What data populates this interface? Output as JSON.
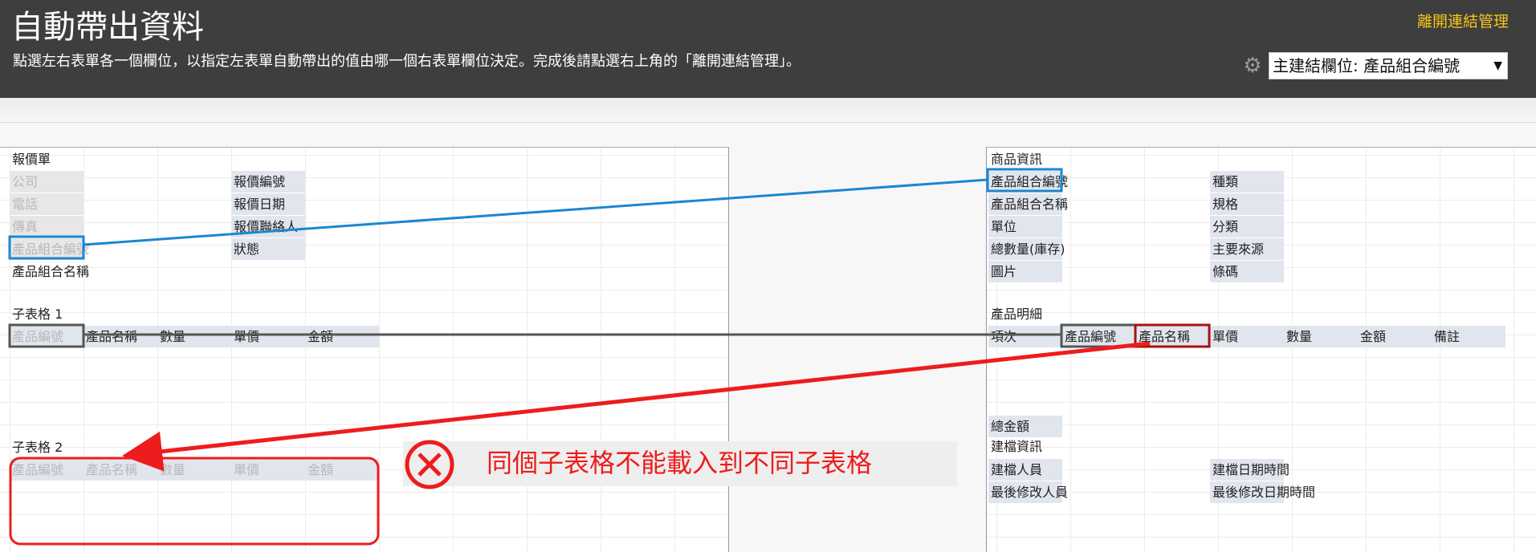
{
  "header": {
    "title": "自動帶出資料",
    "description": "點選左右表單各一個欄位，以指定左表單自動帶出的值由哪一個右表單欄位決定。完成後請點選右上角的「離開連結管理」。",
    "exit_link": "離開連結管理",
    "settings_icon": "gear-icon",
    "main_link_select": "主建結欄位: 產品組合編號"
  },
  "left_form": {
    "title": "報價單",
    "fields_col1": [
      "公司",
      "電話",
      "傳真",
      "產品組合編號",
      "產品組合名稱"
    ],
    "fields_col2": [
      "報價編號",
      "報價日期",
      "報價聯絡人",
      "狀態"
    ],
    "subtable1": {
      "title": "子表格 1",
      "columns": [
        "產品編號",
        "產品名稱",
        "數量",
        "單價",
        "金額"
      ]
    },
    "subtable2": {
      "title": "子表格 2",
      "columns": [
        "產品編號",
        "產品名稱",
        "數量",
        "單價",
        "金額"
      ]
    }
  },
  "right_form": {
    "title": "商品資訊",
    "fields_col1": [
      "產品組合編號",
      "產品組合名稱",
      "單位",
      "總數量(庫存)",
      "圖片"
    ],
    "fields_col2": [
      "種類",
      "規格",
      "分類",
      "主要來源",
      "條碼"
    ],
    "detail": {
      "title": "產品明細",
      "columns": [
        "項次",
        "產品編號",
        "產品名稱",
        "單價",
        "數量",
        "金額",
        "備註"
      ]
    },
    "total_label": "總金額",
    "record_section": "建檔資訊",
    "record_fields": [
      "建檔人員",
      "最後修改人員"
    ],
    "record_fields2": [
      "建檔日期時間",
      "最後修改日期時間"
    ]
  },
  "warning": {
    "text": "同個子表格不能載入到不同子表格",
    "icon": "prohibited-icon"
  }
}
